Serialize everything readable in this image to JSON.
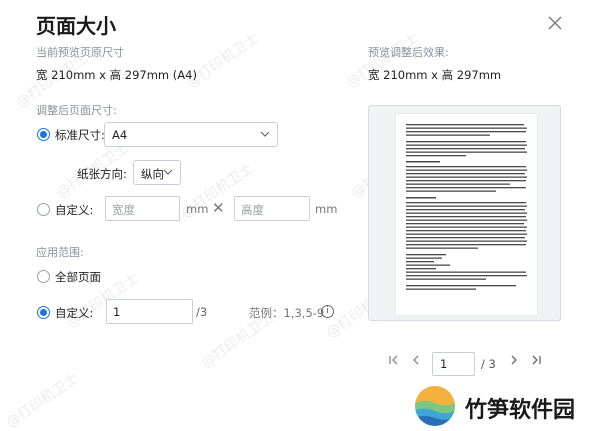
{
  "dialog": {
    "title": "页面大小"
  },
  "current": {
    "heading": "当前预览页原尺寸",
    "size_text": "宽 210mm x 高 297mm (A4)"
  },
  "preview": {
    "heading": "预览调整后效果:",
    "size_text": "宽 210mm x 高 297mm"
  },
  "adjust": {
    "heading": "调整后页面尺寸:",
    "standard_label": "标准尺寸:",
    "standard_value": "A4",
    "orientation_label": "纸张方向:",
    "orientation_value": "纵向",
    "custom_label": "自定义:",
    "width_placeholder": "宽度",
    "height_placeholder": "高度",
    "unit": "mm",
    "times": "✕"
  },
  "range": {
    "heading": "应用范围:",
    "all_label": "全部页面",
    "custom_label": "自定义:",
    "custom_value": "1",
    "total_suffix": "/3",
    "example": "范例：1,3,5-9"
  },
  "pager": {
    "current": "1",
    "total": "/ 3"
  },
  "brand": {
    "name": "竹笋软件园"
  },
  "watermark": {
    "text": "@打印机卫士"
  },
  "colors": {
    "accent": "#1a73e8"
  }
}
